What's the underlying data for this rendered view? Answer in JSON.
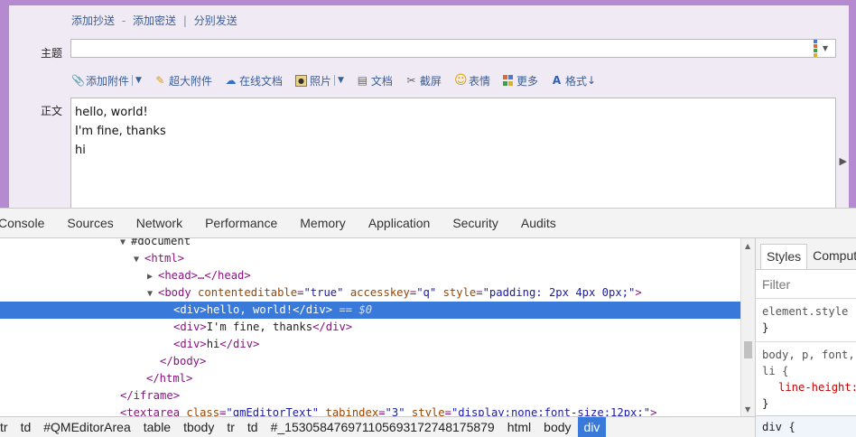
{
  "compose": {
    "cc_links": [
      "添加抄送",
      "添加密送",
      "分别发送"
    ],
    "cc_dash": "-",
    "cc_bar": "|",
    "subject_label": "主题",
    "subject_value": "",
    "toolbar": [
      {
        "icon": "paperclip-icon",
        "label": "添加附件"
      },
      {
        "icon": "large-attachment-icon",
        "label": "超大附件"
      },
      {
        "icon": "online-doc-icon",
        "label": "在线文档"
      },
      {
        "icon": "photo-icon",
        "label": "照片"
      },
      {
        "icon": "document-icon",
        "label": "文档"
      },
      {
        "icon": "scissors-icon",
        "label": "截屏"
      },
      {
        "icon": "smiley-icon",
        "label": "表情"
      },
      {
        "icon": "more-grid-icon",
        "label": "更多"
      },
      {
        "icon": "format-icon",
        "label": "格式"
      }
    ],
    "format_arrow": "↓",
    "body_label": "正文",
    "body_lines": [
      "hello, world!",
      "I'm fine, thanks",
      "hi"
    ],
    "colors": {
      "frame": "#b58ad0",
      "link": "#3b5f99",
      "background": "#efeaf4"
    }
  },
  "devtools": {
    "tabs": [
      "Console",
      "Sources",
      "Network",
      "Performance",
      "Memory",
      "Application",
      "Security",
      "Audits"
    ],
    "dom": {
      "document": "#document",
      "html_open": "<html>",
      "head": "<head>…</head>",
      "body_tag_open": "<body",
      "body_attrs": [
        {
          "name": "contenteditable",
          "value": "\"true\""
        },
        {
          "name": "accesskey",
          "value": "\"q\""
        },
        {
          "name": "style",
          "value": "\"padding: 2px 4px 0px;\""
        }
      ],
      "body_tag_close": ">",
      "div1_open": "<div>",
      "div1_text": "hello, world!",
      "div1_close": "</div>",
      "div1_marker": "== $0",
      "div2_open": "<div>",
      "div2_text": "I'm fine, thanks",
      "div2_close": "</div>",
      "div3_open": "<div>",
      "div3_text": "hi",
      "div3_close": "</div>",
      "body_close": "</body>",
      "html_close": "</html>",
      "iframe_close": "</iframe>",
      "textarea_tag_open": "<textarea",
      "textarea_attrs": [
        {
          "name": "class",
          "value": "\"qmEditorText\""
        },
        {
          "name": "tabindex",
          "value": "\"3\""
        },
        {
          "name": "style",
          "value": "\"display:none;font-size:12px;\""
        }
      ],
      "textarea_tag_close": ">"
    },
    "selection_color": "#3879d9",
    "breadcrumbs": [
      "tr",
      "td",
      "#QMEditorArea",
      "table",
      "tbody",
      "tr",
      "td",
      "#_153058476971105693172748175879",
      "html",
      "body",
      "div"
    ],
    "styles_pane": {
      "tabs": [
        "Styles",
        "Computed"
      ],
      "filter_placeholder": "Filter",
      "rule1_selector": "element.style {",
      "rule1_close": "}",
      "rule2_selector": "body, p, font,",
      "rule2_selector2": "li {",
      "rule2_prop": "line-height:",
      "rule2_close": "}",
      "bottom_rule": "div {"
    }
  }
}
